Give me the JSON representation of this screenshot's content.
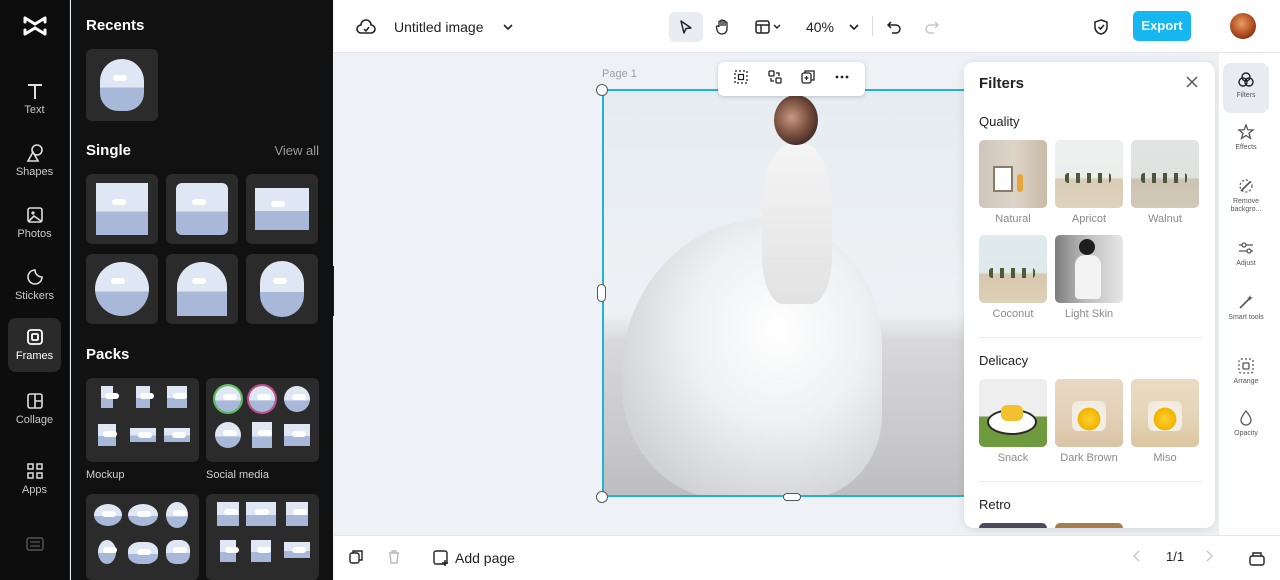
{
  "rail": {
    "items": [
      {
        "label": "Text"
      },
      {
        "label": "Shapes"
      },
      {
        "label": "Photos"
      },
      {
        "label": "Stickers"
      },
      {
        "label": "Frames"
      },
      {
        "label": "Collage"
      },
      {
        "label": "Apps"
      }
    ],
    "active": "Frames"
  },
  "panel": {
    "recents_title": "Recents",
    "single_title": "Single",
    "view_all": "View all",
    "packs_title": "Packs",
    "packs": [
      {
        "label": "Mockup"
      },
      {
        "label": "Social media"
      }
    ]
  },
  "topbar": {
    "doc_title": "Untitled image",
    "zoom": "40%",
    "export_label": "Export"
  },
  "canvas": {
    "page_label": "Page 1"
  },
  "filters": {
    "title": "Filters",
    "sections": [
      {
        "title": "Quality",
        "items": [
          "Natural",
          "Apricot",
          "Walnut",
          "Coconut",
          "Light Skin"
        ]
      },
      {
        "title": "Delicacy",
        "items": [
          "Snack",
          "Dark Brown",
          "Miso"
        ]
      },
      {
        "title": "Retro",
        "items": []
      }
    ]
  },
  "minirail": {
    "items": [
      {
        "label": "Filters"
      },
      {
        "label": "Effects"
      },
      {
        "label": "Remove backgro..."
      },
      {
        "label": "Adjust"
      },
      {
        "label": "Smart tools"
      },
      {
        "label": "Arrange"
      },
      {
        "label": "Opacity"
      }
    ]
  },
  "bottombar": {
    "add_page": "Add page",
    "page_indicator": "1/1"
  },
  "colors": {
    "accent": "#16b7f0",
    "selection": "#1fb3d6",
    "rail_bg": "#0d0d0d",
    "panel_bg": "#111111"
  }
}
